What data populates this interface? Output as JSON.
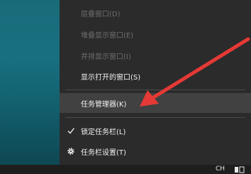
{
  "menu": {
    "items": [
      {
        "label": "层叠窗口(D)"
      },
      {
        "label": "堆叠显示窗口(E)"
      },
      {
        "label": "并排显示窗口(I)"
      },
      {
        "label": "显示打开的窗口(S)"
      },
      {
        "label": "任务管理器(K)"
      },
      {
        "label": "锁定任务栏(L)"
      },
      {
        "label": "任务栏设置(T)"
      }
    ]
  },
  "taskbar": {
    "ime_label": "CH"
  },
  "colors": {
    "menu_bg": "#2b2b2b",
    "highlight": "#414141",
    "arrow": "#e53935",
    "desktop": "#1a6b7a"
  },
  "icons": [
    "check-icon",
    "gear-icon",
    "annotation-arrow"
  ]
}
